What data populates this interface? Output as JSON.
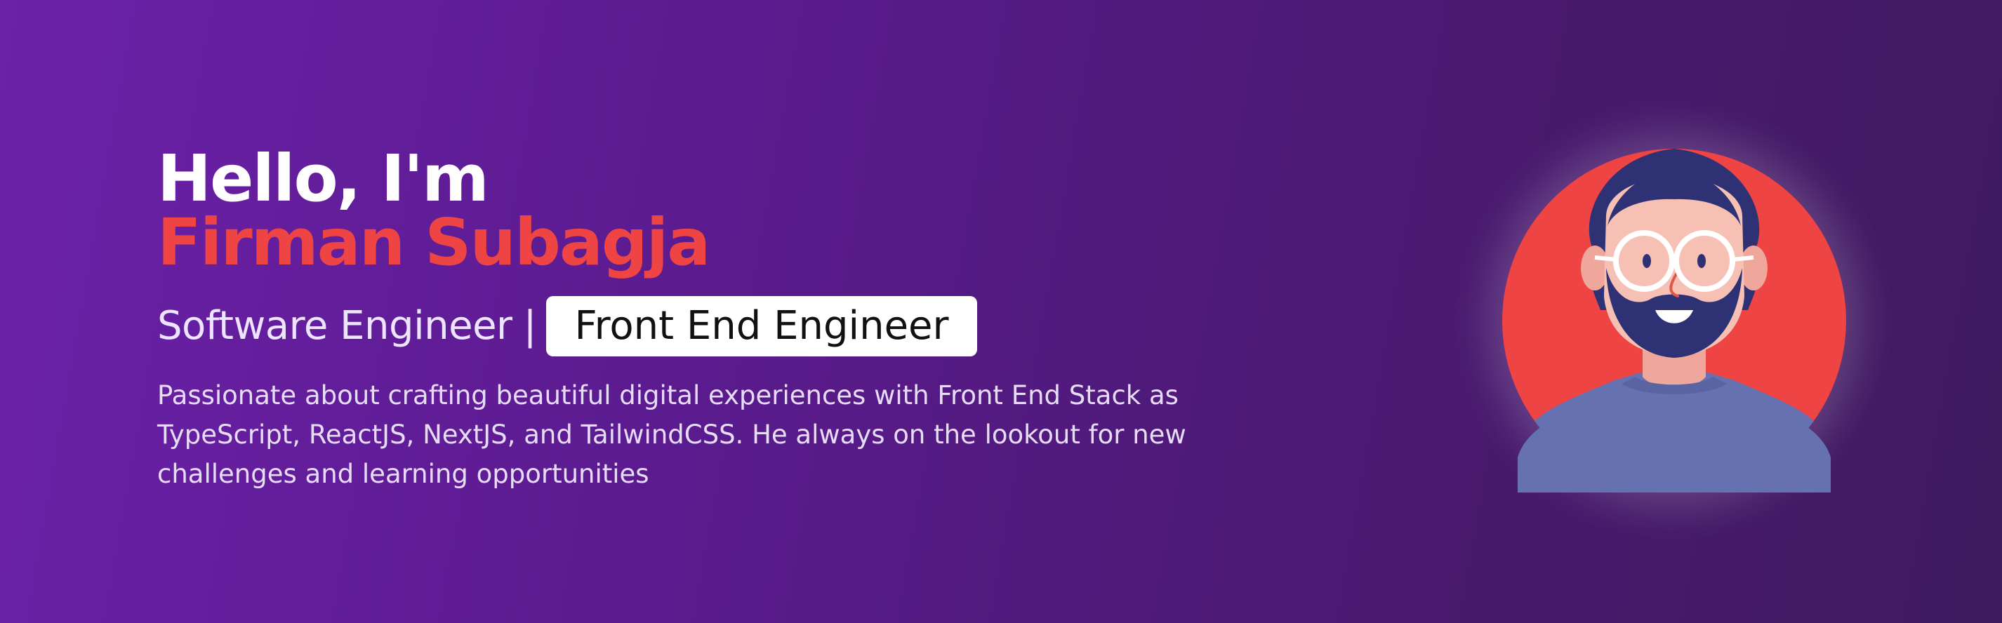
{
  "hero": {
    "greeting": "Hello, I'm",
    "name": "Firman Subagja",
    "role_static": "Software Engineer",
    "role_separator": "|",
    "role_highlight": "Front End Engineer",
    "description_lines": [
      "Passionate about crafting beautiful digital experiences with Front End Stack as",
      "TypeScript, ReactJS, NextJS, and TailwindCSS. He always on the lookout for new",
      "challenges and learning opportunities"
    ]
  },
  "avatar": {
    "icon": "developer-avatar-illustration"
  },
  "colors": {
    "background_start": "#6b21a8",
    "background_end": "#3f1a5e",
    "accent": "#ef4444",
    "badge_bg": "#ffffff"
  }
}
